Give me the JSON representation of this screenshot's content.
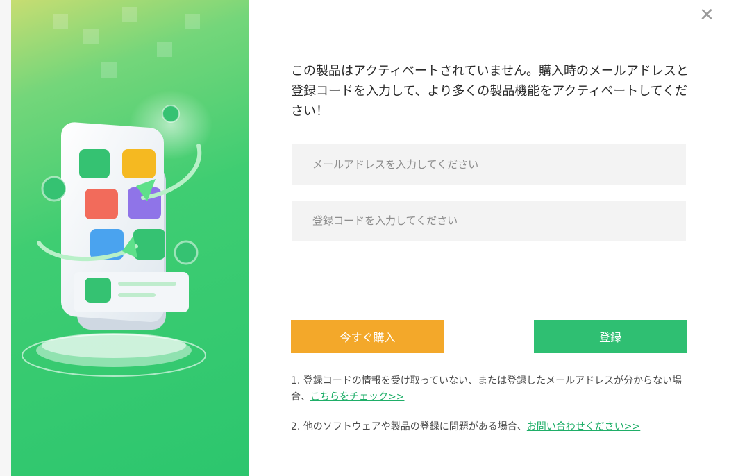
{
  "close": {
    "icon": "close-icon",
    "glyph": "✕"
  },
  "message": "この製品はアクティベートされていません。購入時のメールアドレスと登録コードを入力して、より多くの製品機能をアクティベートしてください！",
  "email": {
    "placeholder": "メールアドレスを入力してください",
    "value": ""
  },
  "code": {
    "placeholder": "登録コードを入力してください",
    "value": ""
  },
  "buttons": {
    "buy": "今すぐ購入",
    "register": "登録"
  },
  "notes": [
    {
      "text": "1. 登録コードの情報を受け取っていない、または登録したメールアドレスが分からない場合、",
      "link": "こちらをチェック>>"
    },
    {
      "text": "2. 他のソフトウェアや製品の登録に問題がある場合、",
      "link": "お問い合わせください>>"
    }
  ],
  "colors": {
    "accent": "#2fbf72",
    "buy": "#f3a82a",
    "link": "#1fae68"
  }
}
